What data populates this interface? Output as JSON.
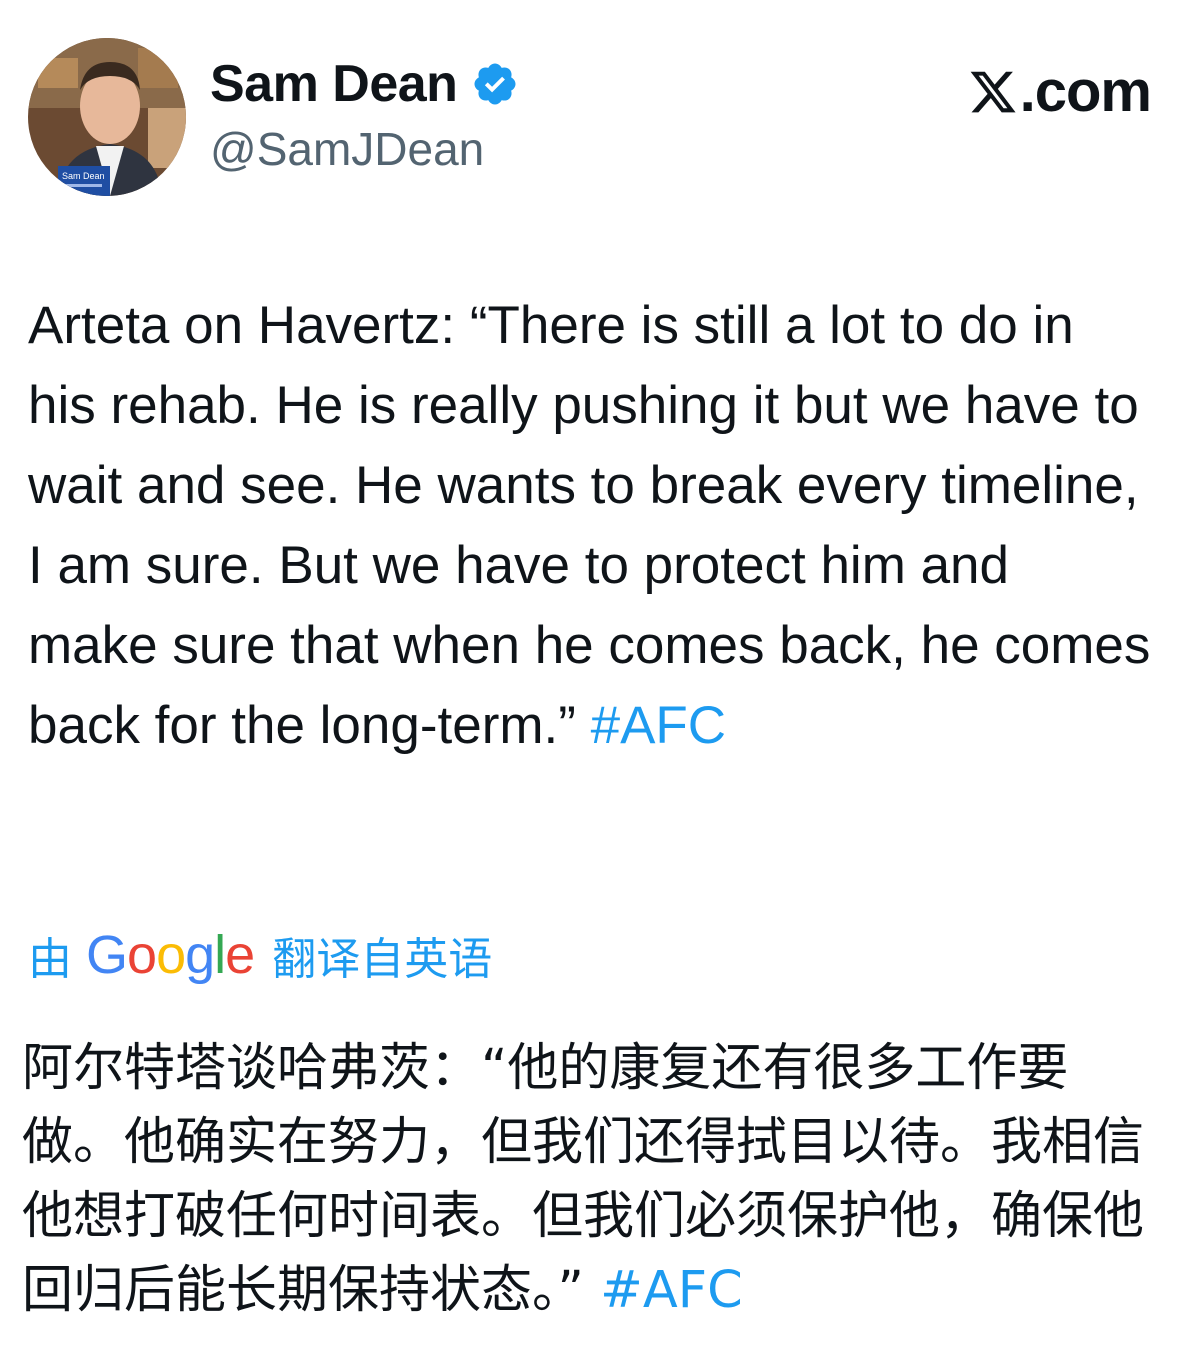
{
  "author": {
    "display_name": "Sam Dean",
    "handle": "@SamJDean",
    "avatar_badge": "Sam Dean",
    "verified": true,
    "verified_color": "#1d9bf0"
  },
  "brand": {
    "label": ".com",
    "icon": "x-logo-icon"
  },
  "tweet": {
    "text": "Arteta on Havertz: “There is still a lot to do in his rehab. He is really pushing it but we have to wait and see. He wants to break every timeline, I am sure. But we have to protect him and make sure that when he comes back, he comes back for the long-term.” ",
    "hashtag": "#AFC"
  },
  "translation": {
    "prefix": "由",
    "provider": {
      "letters": [
        "G",
        "o",
        "o",
        "g",
        "l",
        "e"
      ]
    },
    "suffix": "翻译自英语",
    "text": "阿尔特塔谈哈弗茨：“他的康复还有很多工作要做。他确实在努力，但我们还得拭目以待。我相信他想打破任何时间表。但我们必须保护他，确保他回归后能长期保持状态。” ",
    "hashtag": "#AFC"
  },
  "colors": {
    "link": "#1d9bf0",
    "text": "#0f1419",
    "secondary": "#536471"
  }
}
